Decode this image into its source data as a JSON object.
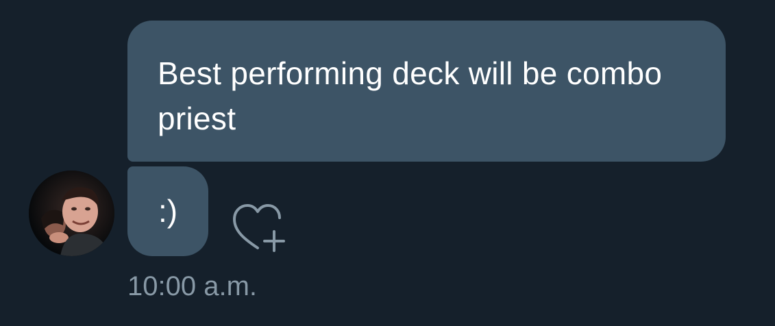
{
  "conversation": {
    "messages": [
      {
        "text": "Best performing deck will be combo priest"
      },
      {
        "text": ":)"
      }
    ],
    "timestamp": "10:00 a.m."
  },
  "icons": {
    "like": "heart-plus-icon",
    "avatar": "profile-photo"
  },
  "colors": {
    "background": "#15202b",
    "bubble": "#3d5466",
    "message_text": "#ffffff",
    "secondary_text": "#8899a6",
    "icon_stroke": "#8899a6"
  }
}
